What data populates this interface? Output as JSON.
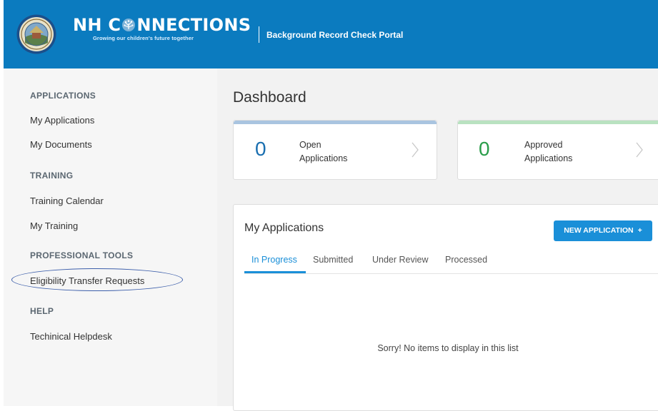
{
  "header": {
    "brand_title_pre": "NH C",
    "brand_title_post": "NNECTIONS",
    "tagline": "Growing our children's future together",
    "portal_name": "Background Record Check Portal"
  },
  "sidebar": {
    "sections": [
      {
        "heading": "APPLICATIONS",
        "items": [
          "My Applications",
          "My Documents"
        ]
      },
      {
        "heading": "TRAINING",
        "items": [
          "Training Calendar",
          "My Training"
        ]
      },
      {
        "heading": "PROFESSIONAL TOOLS",
        "items": [
          "Eligibility Transfer Requests"
        ]
      },
      {
        "heading": "HELP",
        "items": [
          "Techinical Helpdesk"
        ]
      }
    ]
  },
  "dashboard": {
    "title": "Dashboard",
    "cards": [
      {
        "count": "0",
        "label": "Open Applications",
        "bar_color": "#a9c4e0",
        "count_color": "#1a6fb0"
      },
      {
        "count": "0",
        "label": "Approved Applications",
        "bar_color": "#b9e2c0",
        "count_color": "#2a9d4a"
      }
    ]
  },
  "my_applications": {
    "title": "My Applications",
    "new_button": "NEW APPLICATION",
    "new_button_icon": "+",
    "tabs": [
      "In Progress",
      "Submitted",
      "Under Review",
      "Processed"
    ],
    "active_tab": "In Progress",
    "empty_message": "Sorry! No items to display in this list"
  },
  "colors": {
    "header_bg": "#0b7bbf",
    "accent": "#1a8fd8",
    "annotation_circle": "#3c5eaa"
  }
}
